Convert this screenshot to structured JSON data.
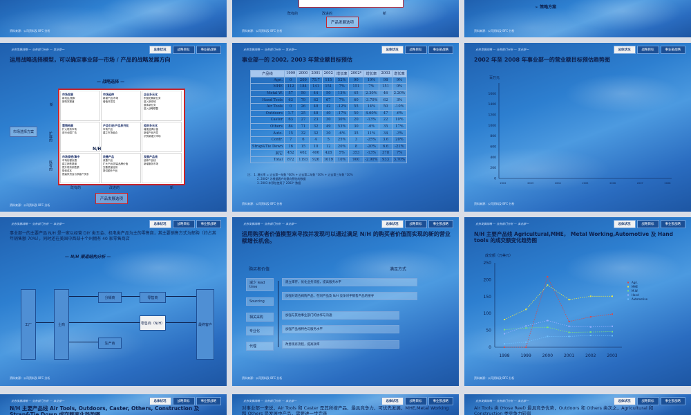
{
  "common": {
    "footer": "资料来源：公司资料及 BFC 分析",
    "crumb": "业务发展战略 — 业务部门分析 — 事业部一",
    "tabs": [
      "总体状况",
      "战略目标",
      "事业部战略"
    ]
  },
  "row0": {
    "s2": {
      "x1": "既有的",
      "x2": "改进的",
      "x3": "新",
      "button": "产品发展选项"
    },
    "s3": {
      "bullet": "策略方案"
    }
  },
  "slide4": {
    "title": "运用战略选择模型，可以确定事业部一市场 / 产品的战略发展方向",
    "heading": "— 战略选择 —",
    "market_button": "市场选择方案",
    "y_labels": [
      "新",
      "扩展的",
      "既有的"
    ],
    "x_labels": [
      "既有的",
      "改进的",
      "新"
    ],
    "center_label": "N/H",
    "product_button": "产品发展选项",
    "cells": [
      {
        "title": "市场发展",
        "lines": [
          "新地区/国家",
          "新购货渠道"
        ]
      },
      {
        "title": "市场延伸",
        "lines": [
          "新增产品/市场",
          "增值开发性"
        ]
      },
      {
        "title": "企业多元化",
        "lines": [
          "积极拓展新业务",
          "进入新领域",
          "整体新业务",
          "进入战略联盟"
        ]
      },
      {
        "title": "营销拓展",
        "lines": [
          "扩大现有市场",
          "进行全国广告"
        ]
      },
      {
        "title": "产品引进/产品系列化",
        "lines": [
          "市场产品",
          "建立市场组合"
        ]
      },
      {
        "title": "相关多元化",
        "lines": [
          "增强品牌价值",
          "新增产品开发",
          "识别新细分市场"
        ]
      },
      {
        "title": "市场渗透/集中",
        "lines": [
          "市场份额渗透",
          "建立销售渠道",
          "提升现有销售额",
          "降低成本",
          "提高供货及与供客户关系"
        ]
      },
      {
        "title": "改善产品",
        "lines": [
          "改善产品",
          "扩大产品/提高品牌价值",
          "完善质量检测",
          "提供额外产品"
        ]
      },
      {
        "title": "发展产品线",
        "lines": [
          "延伸产品线",
          "新增服务市场"
        ]
      }
    ]
  },
  "slide5": {
    "title": "事业部一的 2002, 2003 年营业额目标预估",
    "headers": [
      "产品线",
      "1999",
      "2000",
      "2001",
      "2002",
      "增长率",
      "2002*",
      "增长率",
      "2003",
      "增长率"
    ],
    "rows": [
      [
        "Agri.",
        "0",
        "209",
        "75.7",
        "115",
        "52%",
        "90",
        "19%",
        "98",
        "9%"
      ],
      [
        "MHE",
        "112",
        "184",
        "141",
        "151",
        "7%",
        "151",
        "7%",
        "151",
        "0%"
      ],
      [
        "Metal W.",
        "57",
        "59",
        "44",
        "50",
        "13%",
        "45",
        "2.30%",
        "46",
        "2.20%"
      ],
      [
        "Hand Tools",
        "63",
        "79",
        "62",
        "67",
        "7%",
        "60",
        "-3.70%",
        "62",
        "3%"
      ],
      [
        "Air Tools",
        "0",
        "26",
        "48",
        "42",
        "-12%",
        "55",
        "14%",
        "50",
        "-10%"
      ],
      [
        "Outdoors",
        "1.7",
        "25",
        "48",
        "40",
        "-17%",
        "50",
        "4.60%",
        "47",
        "-6%"
      ],
      [
        "Caster",
        "63",
        "27",
        "23",
        "30",
        "30%",
        "20",
        "-13%",
        "22",
        "10%"
      ],
      [
        "Others",
        "84",
        "71",
        "32",
        "49",
        "53%",
        "30",
        "-6%",
        "35",
        "17%"
      ],
      [
        "Auto.",
        "15",
        "32",
        "32",
        "30",
        "-6%",
        "35",
        "11%",
        "34",
        "-3%"
      ],
      [
        "Contr.",
        "7",
        "6",
        "4",
        "5",
        "25%",
        "3",
        "-25%",
        "3.6",
        "20%"
      ],
      [
        "Strap&Tie Down",
        "16",
        "15",
        "10",
        "12",
        "20%",
        "8",
        "-20%",
        "6.6",
        "-21%"
      ],
      [
        "其它",
        "452",
        "462",
        "406",
        "428",
        "5%",
        "353",
        "-13%",
        "378",
        "7%"
      ],
      [
        "Total",
        "872",
        "1193",
        "926",
        "1019",
        "10%",
        "900",
        "-2.90%",
        "933",
        "3.70%"
      ]
    ],
    "notes": [
      "注： 1. 增长率 = 过去第一年数 *60% + 过去第二年数 *30% + 过去第三年数 *10%",
      "2. 2002* 为根据客户的意向预估的数据",
      "3. 2003 年预估使用了 2002* 数据"
    ]
  },
  "slide6": {
    "title": "2002 年至 2008 年事业部一的营业额目标预估趋势图",
    "y_unit": "百万元"
  },
  "slide7": {
    "intro": "事业部一的主要产品 N/H 是一家以经营 DIY 类五金、机电类产品为主的零售商，其主要销售方式为邮购（约占其年销售额 70%），同时还在美国中西部十个州拥有 40 家零售商店",
    "heading": "— N/H 渠道结构分析 —",
    "boxes": [
      "工厂",
      "士商",
      "分销商",
      "零售商",
      "零售商（N/H）",
      "生产商",
      "最终客户"
    ]
  },
  "slide8": {
    "title": "运用购买者价值模型来寻找并发现可以通过满足 N/H 的购买者价值而实现的新的营业额增长机会。",
    "col1": "购买者价值",
    "col2": "满足方式",
    "values": [
      "减少 lead time",
      "Sourcing",
      "相关采购",
      "专业化",
      "代理"
    ],
    "ways": [
      "建立库存，优化业务流程，提高服务水平",
      "加强对适合阀购产品，在同产品及 N/H 竞争对手销售产品的搜寻",
      "加强与其他事业部门的协作与沟通",
      "加强产品线特色与服务水平",
      "改善现有流程，提高效率"
    ]
  },
  "slide9": {
    "title": "N/H 主要产品线 Agricultural,MHE， Metal Working,Automotive 及 Hand tools 的成交额变化趋势图",
    "y_unit": "成交额（万美元）"
  },
  "row3": {
    "s10": "N/H 主要产品线 Air Tools, Outdoors, Caster, Others, Construction 及 Strap&Tie Down 成交额变化趋势图",
    "s11": "对事业部一来说，Air Tools 和 Caster 是其所搜产品，最具竞争力，可优先发展，MHE,Metal Working 和 Others 是发展中产品，需要进一步完善",
    "s12": "Air Tools 类 (Hose Reel) 最具竞争优势，Outdoors 和 Others 类次之，Agricultural 和 Construction 类竞争力较弱"
  },
  "chart_data": [
    {
      "type": "line",
      "title": "2002 年至 2008 年事业部一的营业额目标预估趋势图",
      "ylabel": "百万元",
      "x": [
        "2002",
        "2003",
        "2004",
        "2005",
        "2006",
        "2007",
        "2008"
      ],
      "ylim": [
        0,
        1800
      ],
      "yticks": [
        "0",
        "200",
        "400",
        "600",
        "800",
        "1000",
        "1200",
        "1400",
        "1600"
      ],
      "series": []
    },
    {
      "type": "line",
      "title": "N/H 主要产品线 Agricultural,MHE， Metal Working,Automotive 及 Hand tools 的成交额变化趋势图",
      "ylabel": "成交额（万美元）",
      "x": [
        "1998",
        "1999",
        "2000",
        "2001",
        "2002",
        "2003"
      ],
      "ylim": [
        0,
        250
      ],
      "yticks": [
        "0",
        "50",
        "100",
        "150",
        "200",
        "250"
      ],
      "legend": "right",
      "series": [
        {
          "name": "Agri.",
          "color": "#d84a4a",
          "values": [
            0,
            0,
            209,
            76,
            90,
            98
          ]
        },
        {
          "name": "MHE",
          "color": "#e8e84a",
          "values": [
            82,
            112,
            184,
            141,
            151,
            151
          ]
        },
        {
          "name": "M.W.",
          "color": "#7de07d",
          "values": [
            52,
            57,
            59,
            44,
            45,
            46
          ]
        },
        {
          "name": "Hand",
          "color": "#9ab0ff",
          "values": [
            40,
            63,
            79,
            62,
            60,
            62
          ]
        },
        {
          "name": "Automotive",
          "color": "#6fc0ff",
          "values": [
            10,
            15,
            32,
            32,
            35,
            34
          ]
        }
      ]
    }
  ]
}
